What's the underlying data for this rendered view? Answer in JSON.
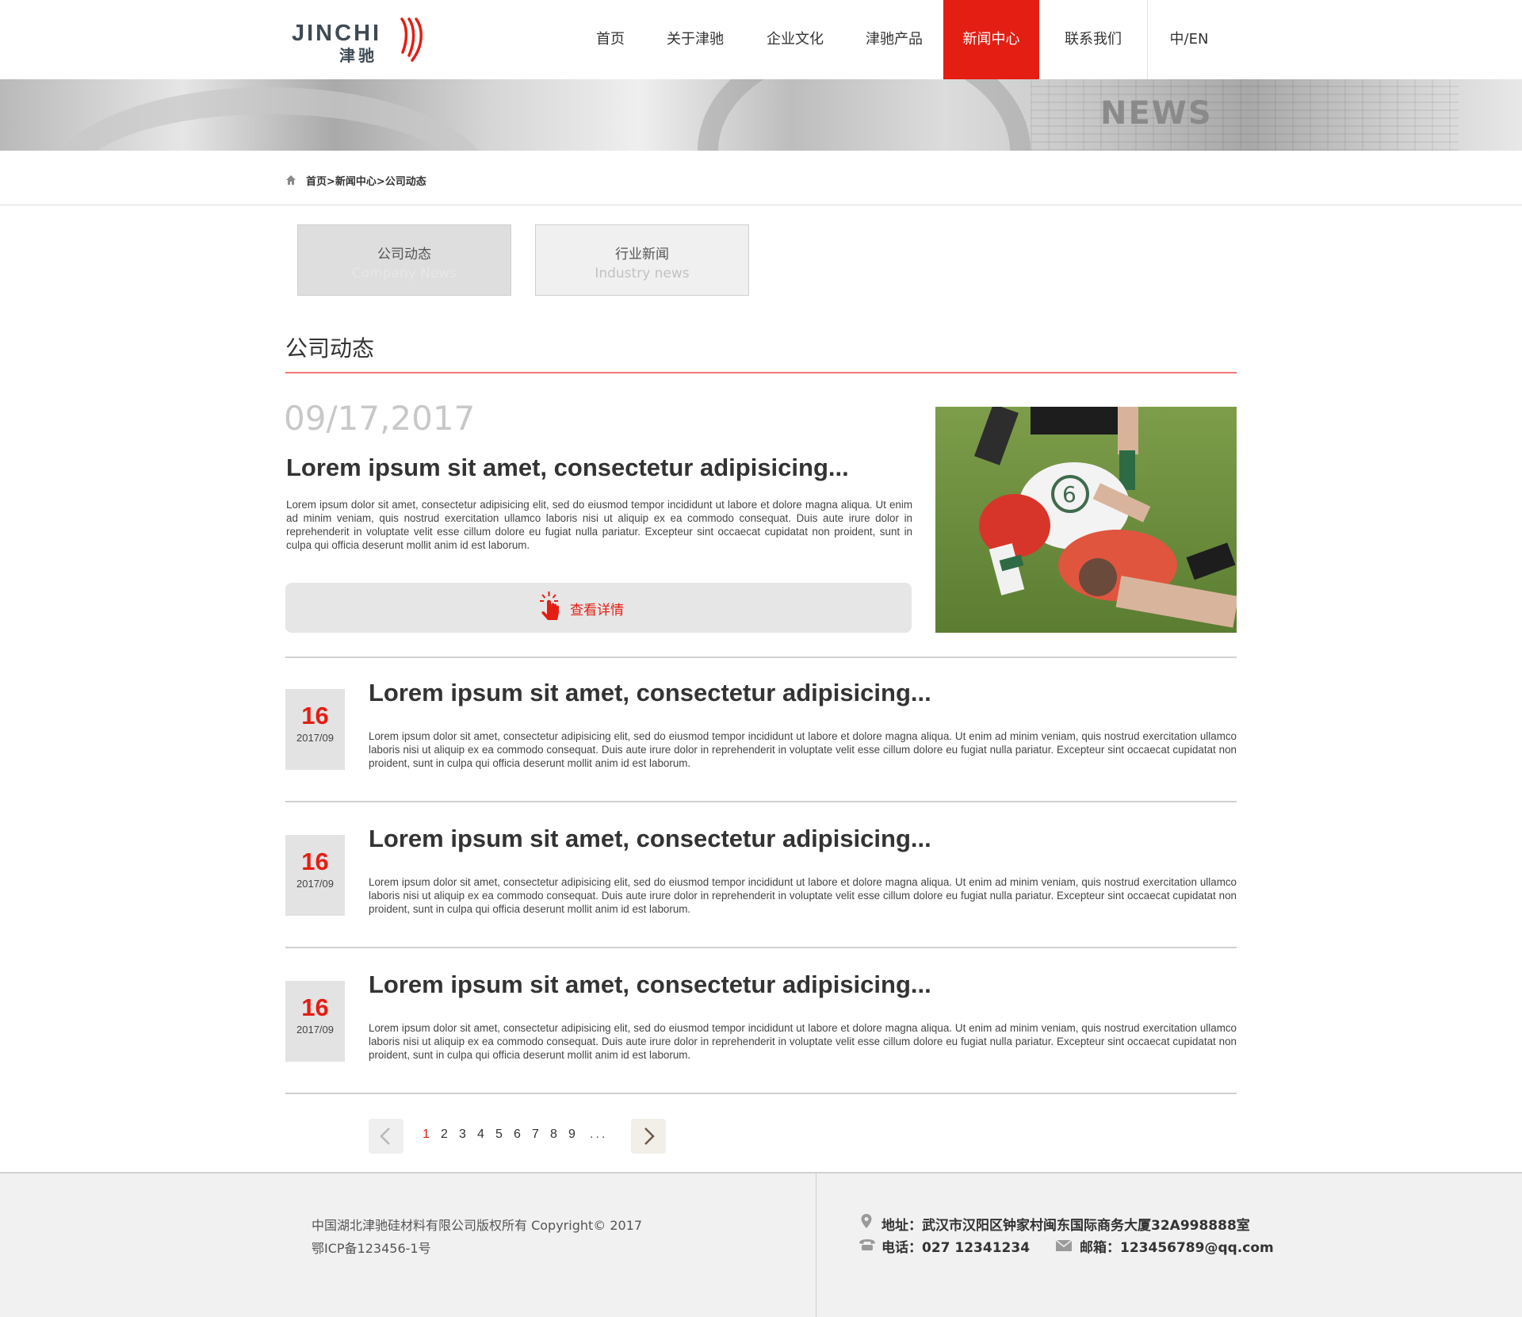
{
  "brand": {
    "logo_en": "JINCHI",
    "logo_cn": "津驰",
    "accent_color": "#e41e13"
  },
  "nav": {
    "items": [
      {
        "label": "首页"
      },
      {
        "label": "关于津驰"
      },
      {
        "label": "企业文化"
      },
      {
        "label": "津驰产品"
      },
      {
        "label": "新闻中心",
        "active": true
      },
      {
        "label": "联系我们"
      }
    ],
    "lang": "中/EN"
  },
  "banner": {
    "title": "NEWS"
  },
  "breadcrumb": {
    "icon": "home-icon",
    "text": "首页>新闻中心>公司动态"
  },
  "tabs": [
    {
      "label_cn": "公司动态",
      "label_en": "Company News",
      "active": true
    },
    {
      "label_cn": "行业新闻",
      "label_en": "Industry news",
      "active": false
    }
  ],
  "section": {
    "title": "公司动态"
  },
  "featured": {
    "date": "09/17,2017",
    "title": "Lorem ipsum sit amet, consectetur adipisicing...",
    "body": "Lorem ipsum dolor sit amet, consectetur adipisicing elit, sed do eiusmod tempor incididunt ut labore et dolore magna aliqua. Ut enim ad minim veniam, quis nostrud exercitation ullamco laboris nisi ut aliquip ex ea commodo consequat. Duis aute irure dolor in reprehenderit in voluptate velit esse cillum dolore eu fugiat nulla pariatur. Excepteur sint occaecat cupidatat non proident, sunt in culpa qui officia deserunt mollit anim id est laborum.",
    "button_label": "查看详情",
    "button_icon": "hand-pointer-icon",
    "image": "rugby-players-photo"
  },
  "news": [
    {
      "day": "16",
      "year_month": "2017/09",
      "title": "Lorem ipsum sit amet, consectetur adipisicing...",
      "body": "Lorem ipsum dolor sit amet, consectetur adipisicing elit, sed do eiusmod tempor incididunt ut labore et dolore magna aliqua. Ut enim ad minim veniam, quis nostrud exercitation ullamco laboris nisi ut aliquip ex ea commodo consequat. Duis aute irure dolor in reprehenderit in voluptate velit esse cillum dolore eu fugiat nulla pariatur. Excepteur sint occaecat cupidatat non proident, sunt in culpa qui officia deserunt mollit anim id est laborum."
    },
    {
      "day": "16",
      "year_month": "2017/09",
      "title": "Lorem ipsum sit amet, consectetur adipisicing...",
      "body": "Lorem ipsum dolor sit amet, consectetur adipisicing elit, sed do eiusmod tempor incididunt ut labore et dolore magna aliqua. Ut enim ad minim veniam, quis nostrud exercitation ullamco laboris nisi ut aliquip ex ea commodo consequat. Duis aute irure dolor in reprehenderit in voluptate velit esse cillum dolore eu fugiat nulla pariatur. Excepteur sint occaecat cupidatat non proident, sunt in culpa qui officia deserunt mollit anim id est laborum."
    },
    {
      "day": "16",
      "year_month": "2017/09",
      "title": "Lorem ipsum sit amet, consectetur adipisicing...",
      "body": "Lorem ipsum dolor sit amet, consectetur adipisicing elit, sed do eiusmod tempor incididunt ut labore et dolore magna aliqua. Ut enim ad minim veniam, quis nostrud exercitation ullamco laboris nisi ut aliquip ex ea commodo consequat. Duis aute irure dolor in reprehenderit in voluptate velit esse cillum dolore eu fugiat nulla pariatur. Excepteur sint occaecat cupidatat non proident, sunt in culpa qui officia deserunt mollit anim id est laborum."
    }
  ],
  "pagination": {
    "pages": [
      "1",
      "2",
      "3",
      "4",
      "5",
      "6",
      "7",
      "8",
      "9"
    ],
    "current": "1",
    "ellipsis": "...",
    "prev_icon": "chevron-left-icon",
    "next_icon": "chevron-right-icon"
  },
  "footer": {
    "copyright": "中国湖北津驰硅材料有限公司版权所有 Copyright© 2017",
    "icp": "鄂ICP备123456-1号",
    "address": "地址：武汉市汉阳区钟家村闽东国际商务大厦32A998888室",
    "phone": "电话：027 12341234",
    "email": "邮箱：123456789@qq.com"
  }
}
